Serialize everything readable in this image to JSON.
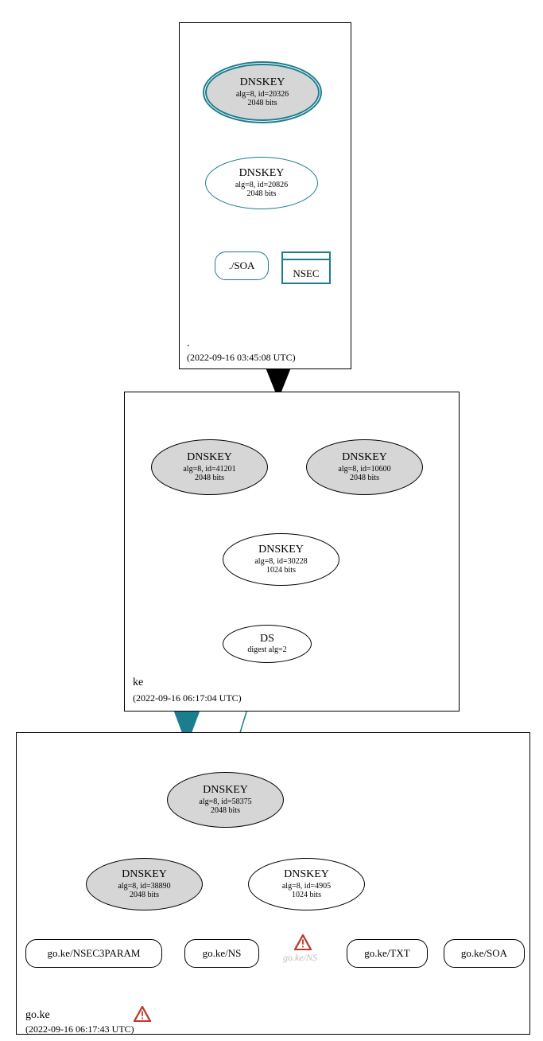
{
  "zones": {
    "root": {
      "label": ".",
      "time": "(2022-09-16 03:45:08 UTC)"
    },
    "ke": {
      "label": "ke",
      "time": "(2022-09-16 06:17:04 UTC)"
    },
    "goke": {
      "label": "go.ke",
      "time": "(2022-09-16 06:17:43 UTC)"
    }
  },
  "nodes": {
    "root_ksk": {
      "t": "DNSKEY",
      "s1": "alg=8, id=20326",
      "s2": "2048 bits"
    },
    "root_zsk": {
      "t": "DNSKEY",
      "s1": "alg=8, id=20826",
      "s2": "2048 bits"
    },
    "root_soa": {
      "t": "./SOA"
    },
    "root_nsec": {
      "t": "NSEC"
    },
    "ke_dk1": {
      "t": "DNSKEY",
      "s1": "alg=8, id=41201",
      "s2": "2048 bits"
    },
    "ke_dk2": {
      "t": "DNSKEY",
      "s1": "alg=8, id=10600",
      "s2": "2048 bits"
    },
    "ke_zsk": {
      "t": "DNSKEY",
      "s1": "alg=8, id=30228",
      "s2": "1024 bits"
    },
    "ke_ds": {
      "t": "DS",
      "s1": "digest alg=2"
    },
    "gk_ksk": {
      "t": "DNSKEY",
      "s1": "alg=8, id=58375",
      "s2": "2048 bits"
    },
    "gk_dk2": {
      "t": "DNSKEY",
      "s1": "alg=8, id=38890",
      "s2": "2048 bits"
    },
    "gk_zsk": {
      "t": "DNSKEY",
      "s1": "alg=8, id=4905",
      "s2": "1024 bits"
    },
    "gk_nsec3p": {
      "t": "go.ke/NSEC3PARAM"
    },
    "gk_ns": {
      "t": "go.ke/NS"
    },
    "gk_ns_fade": {
      "t": "go.ke/NS"
    },
    "gk_txt": {
      "t": "go.ke/TXT"
    },
    "gk_soa": {
      "t": "go.ke/SOA"
    }
  }
}
